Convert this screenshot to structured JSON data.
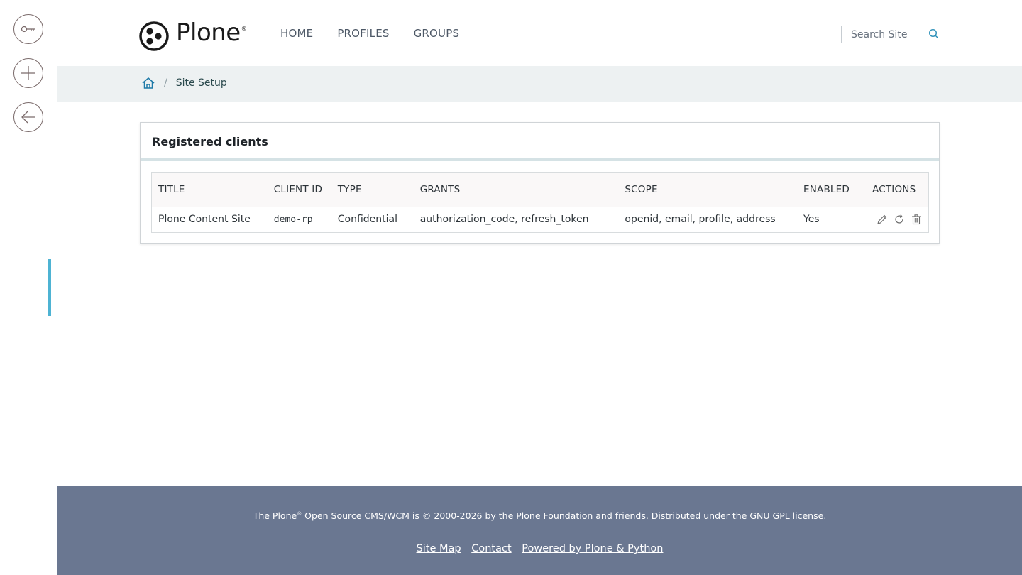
{
  "header": {
    "logo_text": "Plone",
    "logo_reg": "®",
    "nav": [
      "HOME",
      "PROFILES",
      "GROUPS"
    ],
    "search_placeholder": "Search Site"
  },
  "toolbar": {
    "items": [
      "key-icon",
      "add-icon",
      "back-arrow-icon"
    ],
    "accent_color": "#4eb3d3"
  },
  "breadcrumb": {
    "current": "Site Setup"
  },
  "card": {
    "title": "Registered clients",
    "columns": [
      "TITLE",
      "CLIENT ID",
      "TYPE",
      "GRANTS",
      "SCOPE",
      "ENABLED",
      "ACTIONS"
    ],
    "rows": [
      {
        "title": "Plone Content Site",
        "client_id": "demo-rp",
        "type": "Confidential",
        "grants": "authorization_code, refresh_token",
        "scope": "openid, email, profile, address",
        "enabled": "Yes",
        "actions": [
          "edit-icon",
          "refresh-icon",
          "delete-icon"
        ]
      }
    ]
  },
  "footer": {
    "line1_prefix": "The Plone",
    "line1_reg": "®",
    "line1_mid": " Open Source CMS/WCM is ",
    "line1_copy": "©",
    "line1_years": " 2000-2026 by the ",
    "foundation_link": "Plone Foundation",
    "line1_after": " and friends. Distributed under the ",
    "license_link": "GNU GPL license",
    "line1_end": ".",
    "links": [
      "Site Map",
      "Contact",
      "Powered by Plone & Python"
    ],
    "bg_color": "#6a7791"
  }
}
